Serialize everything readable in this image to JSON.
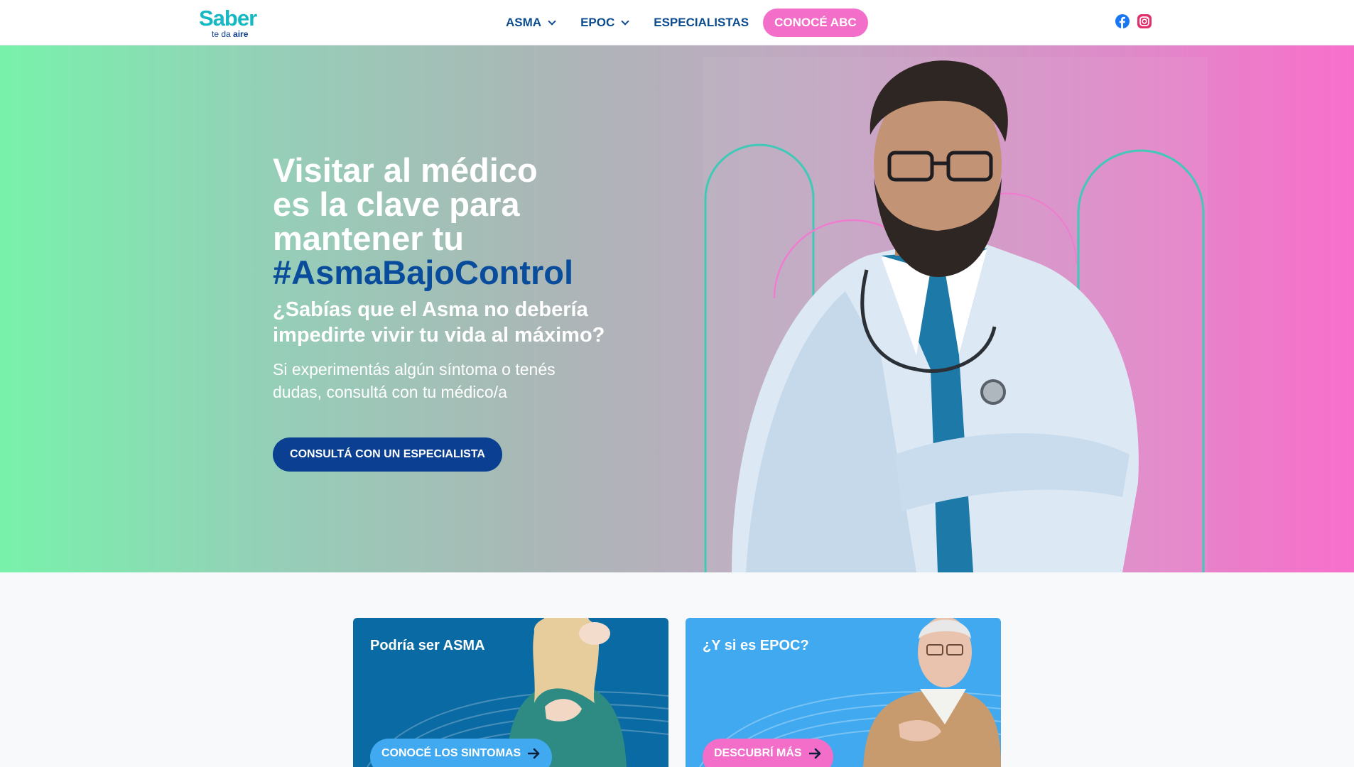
{
  "brand": {
    "logo_main": "Saber",
    "logo_sub_prefix": "te da",
    "logo_sub_bold": "aire"
  },
  "nav": {
    "items": [
      {
        "label": "ASMA",
        "has_dropdown": true
      },
      {
        "label": "EPOC",
        "has_dropdown": true
      },
      {
        "label": "ESPECIALISTAS",
        "has_dropdown": false
      }
    ],
    "cta_label": "CONOCÉ ABC",
    "social": [
      "facebook-icon",
      "instagram-icon"
    ]
  },
  "hero": {
    "title_lines": [
      "Visitar al médico",
      "es la clave para",
      "mantener tu"
    ],
    "hashtag": "#AsmaBajoControl",
    "subtitle": "¿Sabías que el Asma no debería impedirte vivir tu vida al máximo?",
    "body": "Si experimentás algún síntoma o tenés dudas, consultá con tu médico/a",
    "button_label": "CONSULTÁ CON UN ESPECIALISTA"
  },
  "cards": [
    {
      "title": "Podría ser ASMA",
      "button_label": "CONOCÉ LOS SINTOMAS"
    },
    {
      "title": "¿Y si es EPOC?",
      "button_label": "DESCUBRÍ MÁS"
    }
  ],
  "colors": {
    "navy": "#0a3f91",
    "nav_text": "#0d4d8f",
    "pink": "#f26ec8",
    "teal": "#16b8c4",
    "hero_left": "#78f2ab",
    "hero_right": "#f86fcb",
    "card_asma": "#0a6aa3",
    "card_epoc": "#40a9f0"
  }
}
